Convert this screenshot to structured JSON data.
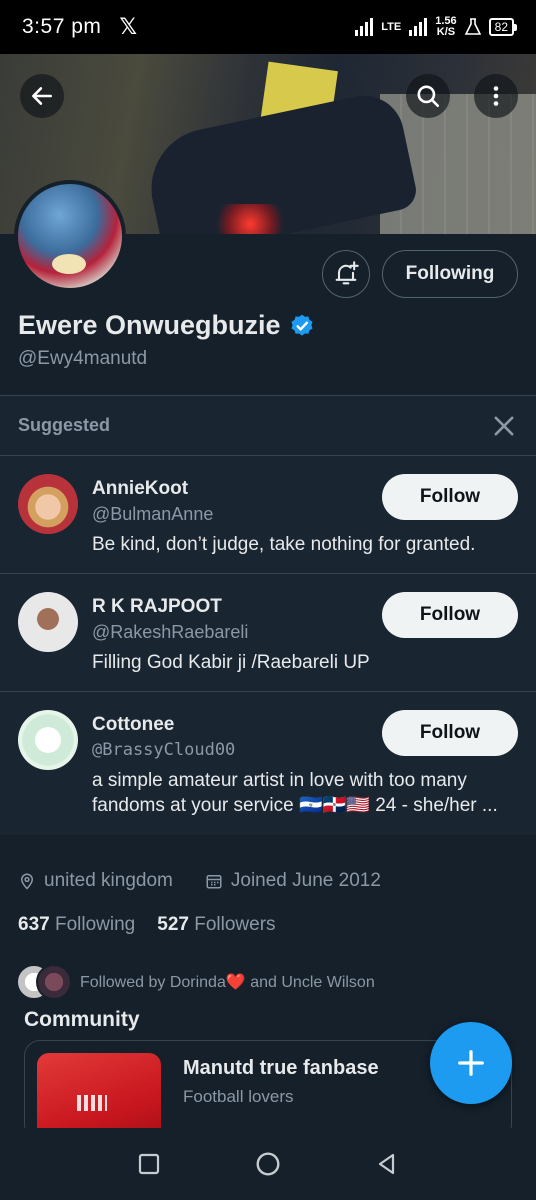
{
  "status_bar": {
    "time": "3:57 pm",
    "x_logo": "𝕏",
    "network": "LTE",
    "speed_value": "1.56",
    "speed_unit": "K/S",
    "battery": "82"
  },
  "profile": {
    "display_name": "Ewere Onwuegbuzie",
    "handle": "@Ewy4manutd",
    "following_button": "Following",
    "location": "united kingdom",
    "joined": "Joined June 2012",
    "following_count": "637",
    "following_label": "Following",
    "followers_count": "527",
    "followers_label": "Followers",
    "followed_by": "Followed by Dorinda❤️ and Uncle Wilson"
  },
  "suggested": {
    "title": "Suggested",
    "items": [
      {
        "name": "AnnieKoot",
        "handle": "@BulmanAnne",
        "bio": "Be kind, don’t judge, take nothing for granted.",
        "button": "Follow"
      },
      {
        "name": "R K RAJPOOT",
        "handle": "@RakeshRaebareli",
        "bio": "Filling God Kabir ji /Raebareli UP",
        "button": "Follow"
      },
      {
        "name": "Cottonee",
        "handle": "@BrassyCloud00",
        "bio": "a simple amateur artist in love with too many fandoms at your service 🇸🇻🇩🇴🇺🇸 24 - she/her ...",
        "button": "Follow"
      }
    ]
  },
  "community": {
    "title": "Community",
    "name": "Manutd true fanbase",
    "description": "Football lovers"
  },
  "colors": {
    "background": "#15202b",
    "accent": "#1d9bf0",
    "muted_text": "#8b98a5"
  }
}
